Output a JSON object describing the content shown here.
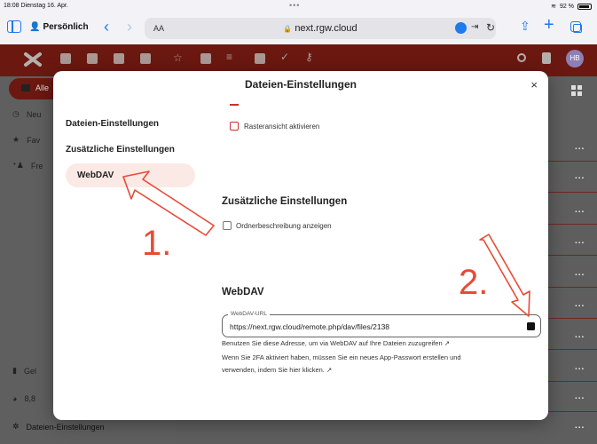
{
  "status_bar": {
    "time": "18:08",
    "date": "Dienstag 16. Apr.",
    "dots": "•••",
    "battery": "92 %"
  },
  "safari": {
    "profile": "Persönlich",
    "aa": "AA",
    "url": "next.rgw.cloud"
  },
  "nc_header": {
    "avatar_initials": "HB"
  },
  "background_app": {
    "sidebar": [
      "Alle Dateien",
      "Neu",
      "Favoriten",
      "Freigaben",
      "Gelöschte Dateien",
      "8,8",
      "Dateien-Einstellungen"
    ],
    "visible_fragments": [
      "Alle",
      "Neu",
      "Fav",
      "Fre",
      "Gel",
      "8,8"
    ],
    "row_more": "..."
  },
  "modal": {
    "title": "Dateien-Einstellungen",
    "close": "×",
    "nav": {
      "items": [
        "Dateien-Einstellungen",
        "Zusätzliche Einstellungen",
        "WebDAV"
      ],
      "active": "WebDAV"
    },
    "grid_label": "Rasteransicht aktivieren",
    "extra_heading": "Zusätzliche Einstellungen",
    "folder_desc_label": "Ordnerbeschreibung anzeigen",
    "webdav_heading": "WebDAV",
    "url_label": "WebDAV-URL",
    "url_value": "https://next.rgw.cloud/remote.php/dav/files/2138",
    "help_line1": "Benutzen Sie diese Adresse, um via WebDAV auf Ihre Dateien zuzugreifen ↗",
    "help_line2": "Wenn Sie 2FA aktiviert haben, müssen Sie ein neues App-Passwort erstellen und",
    "help_line3": "verwenden, indem Sie hier klicken. ↗"
  },
  "annotations": {
    "step1": "1.",
    "step2": "2."
  },
  "colors": {
    "accent": "#c8312a",
    "annotation": "#e94a35",
    "nc_header": "#6b1810",
    "safari_blue": "#1f7aec"
  }
}
